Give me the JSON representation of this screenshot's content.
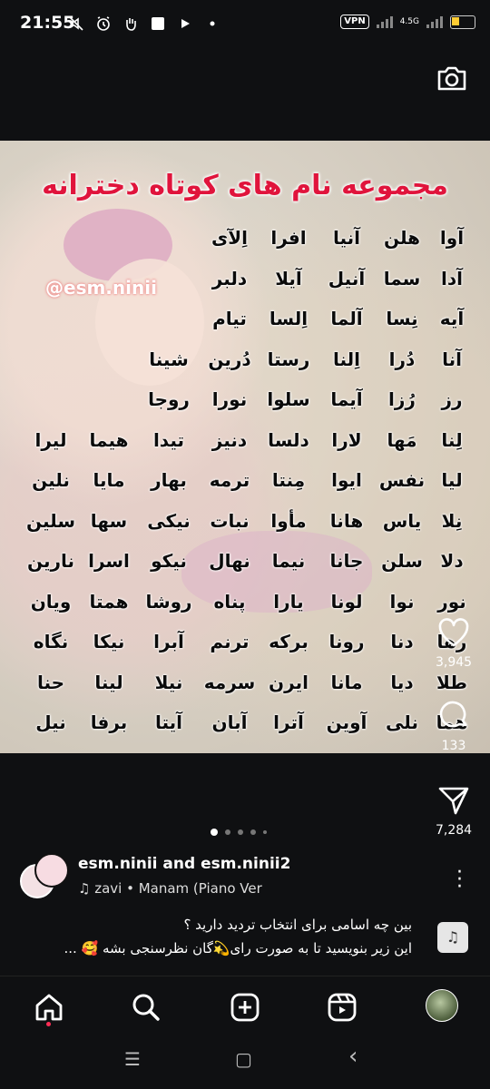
{
  "status_bar": {
    "time": "21:55",
    "vpn": "VPN",
    "network": "4.5G",
    "icons": [
      "muted-icon",
      "alarm-icon",
      "hand-icon",
      "square-icon",
      "play-icon",
      "dot-icon"
    ]
  },
  "post": {
    "title": "مجموعه نام های کوتاه دخترانه",
    "watermark": "@esm.ninii",
    "names": [
      [
        "آوا",
        "هلن",
        "آنیا",
        "افرا",
        "اِلآی"
      ],
      [
        "آدا",
        "سما",
        "آنیل",
        "آیلا",
        "دلبر"
      ],
      [
        "آیه",
        "نِسا",
        "آلما",
        "اِلسا",
        "تیام"
      ],
      [
        "آنا",
        "دُرا",
        "اِلنا",
        "رستا",
        "دُرین",
        "شینا"
      ],
      [
        "رز",
        "رُزا",
        "آیما",
        "سلوا",
        "نورا",
        "روجا"
      ],
      [
        "لِنا",
        "مَها",
        "لارا",
        "دلسا",
        "دنیز",
        "تیدا",
        "هیما",
        "لیرا"
      ],
      [
        "لیا",
        "نفس",
        "ایوا",
        "مِنتا",
        "ترمه",
        "بهار",
        "مایا",
        "نلین"
      ],
      [
        "نِلا",
        "یاس",
        "هانا",
        "مأوا",
        "نبات",
        "نیکی",
        "سها",
        "سلین"
      ],
      [
        "دلا",
        "سلن",
        "جانا",
        "نیما",
        "نهال",
        "نیکو",
        "اسرا",
        "نارین"
      ],
      [
        "نور",
        "نوا",
        "لونا",
        "یارا",
        "پناه",
        "روشا",
        "همتا",
        "ویان"
      ],
      [
        "رها",
        "دنا",
        "رونا",
        "برکه",
        "ترنم",
        "آبرا",
        "نیکا",
        "نگاه"
      ],
      [
        "طلا",
        "دیا",
        "مانا",
        "ایرن",
        "سرمه",
        "نیلا",
        "لینا",
        "حنا"
      ],
      [
        "هما",
        "نلی",
        "آوین",
        "آترا",
        "آبان",
        "آیتا",
        "برفا",
        "نیل"
      ]
    ]
  },
  "actions": {
    "likes": "3,945",
    "comments": "133",
    "shares": "7,284"
  },
  "carousel": {
    "total": 5,
    "active": 0
  },
  "author": {
    "names": "esm.ninii and esm.ninii2",
    "music": "zavi • Manam (Piano Ver"
  },
  "caption": {
    "line1": "بین چه اسامی برای انتخاب تردید دارید ؟",
    "line2": "این زیر بنویسید تا به صورت رای💫گان نظرسنجی بشه 🥰 ..."
  },
  "nav": [
    "home-icon",
    "search-icon",
    "create-icon",
    "reels-icon",
    "profile-avatar"
  ],
  "system_nav": {
    "recents": "☰",
    "home": "▢",
    "back": "‹"
  }
}
